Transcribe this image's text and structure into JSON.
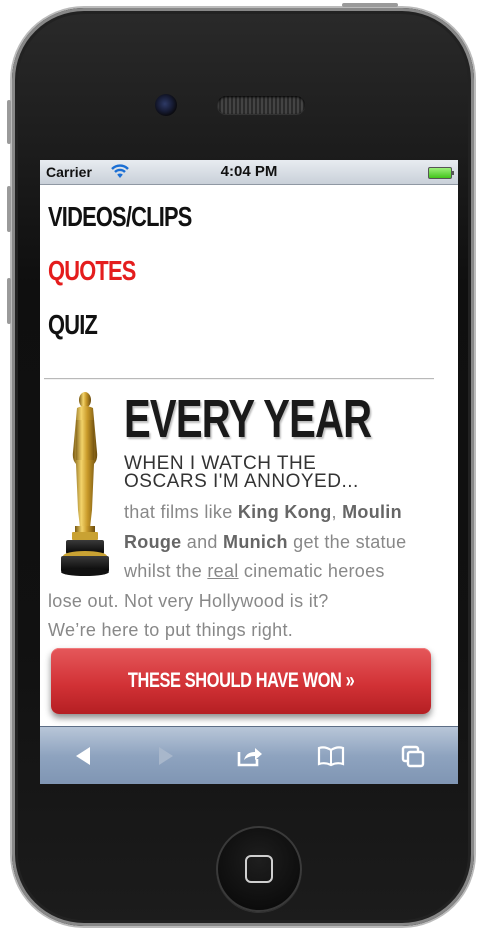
{
  "status_bar": {
    "carrier": "Carrier",
    "time": "4:04 PM"
  },
  "nav": {
    "items": [
      {
        "label": "VIDEOS/CLIPS",
        "active": false
      },
      {
        "label": "QUOTES",
        "active": true
      },
      {
        "label": "QUIZ",
        "active": false
      }
    ]
  },
  "hero": {
    "title": "EVERY YEAR",
    "subtitle_line1": "WHEN I WATCH THE",
    "subtitle_line2": "OSCARS I'M ANNOYED...",
    "body": {
      "l1_a": "that films like ",
      "l1_b": "King Kong",
      "l1_c": ", ",
      "l1_d": "Moulin",
      "l2_a": "Rouge",
      "l2_b": " and ",
      "l2_c": "Munich",
      "l2_d": " get the statue",
      "l3_a": "whilst the ",
      "l3_b": "real",
      "l3_c": " cinematic heroes",
      "l4": "lose out. Not very Hollywood is it?",
      "l5": "We’re here to put things right."
    }
  },
  "cta": {
    "label": "THESE SHOULD HAVE WON »"
  },
  "toolbar": {
    "icons": [
      "back-arrow-icon",
      "forward-arrow-icon",
      "share-icon",
      "bookmarks-icon",
      "tabs-icon"
    ]
  },
  "colors": {
    "accent_red": "#e41d1d",
    "cta_red": "#d23236",
    "toolbar_blue": "#8ea3bf"
  }
}
